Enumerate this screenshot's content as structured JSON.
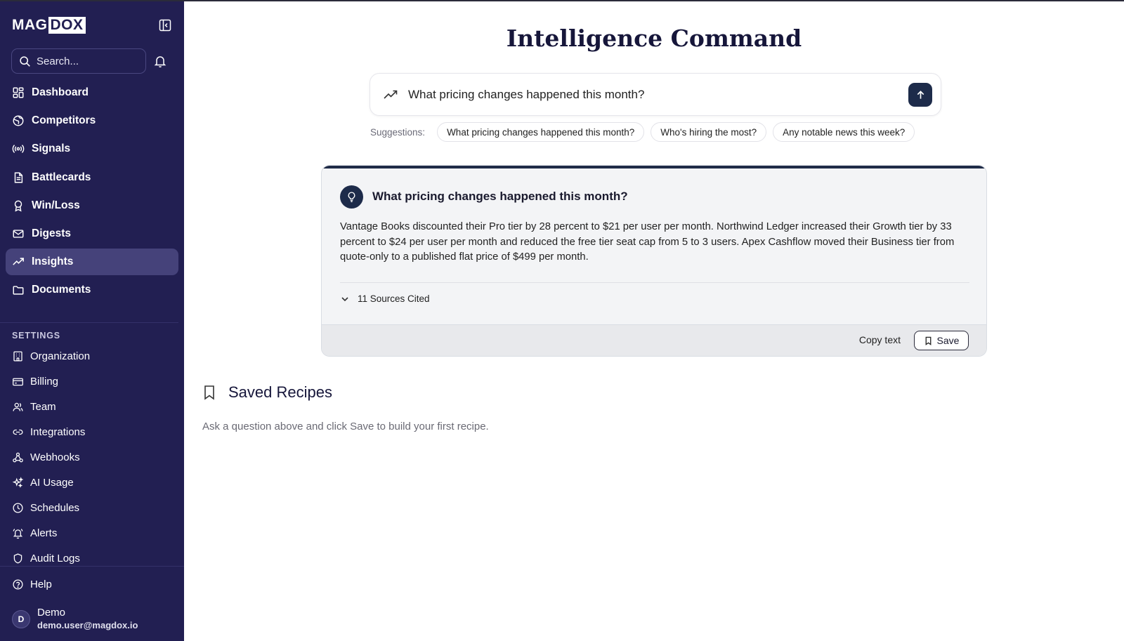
{
  "brand": {
    "part1": "MAG",
    "part2": "DOX"
  },
  "search": {
    "placeholder": "Search..."
  },
  "nav": [
    {
      "label": "Dashboard",
      "icon": "grid-icon"
    },
    {
      "label": "Competitors",
      "icon": "globe-icon"
    },
    {
      "label": "Signals",
      "icon": "broadcast-icon"
    },
    {
      "label": "Battlecards",
      "icon": "document-icon"
    },
    {
      "label": "Win/Loss",
      "icon": "award-icon"
    },
    {
      "label": "Digests",
      "icon": "mail-icon"
    },
    {
      "label": "Insights",
      "icon": "trending-up-icon",
      "active": true
    },
    {
      "label": "Documents",
      "icon": "folder-icon"
    }
  ],
  "settings": {
    "label": "SETTINGS",
    "items": [
      {
        "label": "Organization",
        "icon": "building-icon"
      },
      {
        "label": "Billing",
        "icon": "credit-card-icon"
      },
      {
        "label": "Team",
        "icon": "users-icon"
      },
      {
        "label": "Integrations",
        "icon": "link-icon"
      },
      {
        "label": "Webhooks",
        "icon": "webhook-icon"
      },
      {
        "label": "AI Usage",
        "icon": "sparkles-icon"
      },
      {
        "label": "Schedules",
        "icon": "clock-icon"
      },
      {
        "label": "Alerts",
        "icon": "bell-ring-icon"
      },
      {
        "label": "Audit Logs",
        "icon": "shield-icon"
      }
    ]
  },
  "help": {
    "label": "Help"
  },
  "user": {
    "initial": "D",
    "name": "Demo",
    "email": "demo.user@magdox.io"
  },
  "main": {
    "title": "Intelligence Command",
    "query": "What pricing changes happened this month?",
    "suggestions_label": "Suggestions:",
    "suggestions": [
      "What pricing changes happened this month?",
      "Who's hiring the most?",
      "Any notable news this week?"
    ]
  },
  "answer": {
    "question": "What pricing changes happened this month?",
    "text": "Vantage Books discounted their Pro tier by 28 percent to $21 per user per month. Northwind Ledger increased their Growth tier by 33 percent to $24 per user per month and reduced the free tier seat cap from 5 to 3 users. Apex Cashflow moved their Business tier from quote-only to a published flat price of $499 per month.",
    "sources": "11 Sources Cited",
    "copy_label": "Copy text",
    "save_label": "Save"
  },
  "recipes": {
    "title": "Saved Recipes",
    "empty": "Ask a question above and click Save to build your first recipe."
  },
  "colors": {
    "sidebar": "#221f52",
    "active": "#45427a",
    "accent": "#1d2b4a"
  }
}
